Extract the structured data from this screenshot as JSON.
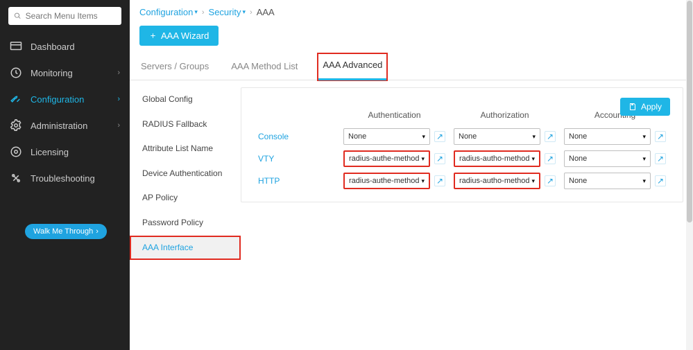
{
  "search": {
    "placeholder": "Search Menu Items"
  },
  "nav": {
    "items": [
      {
        "label": "Dashboard"
      },
      {
        "label": "Monitoring"
      },
      {
        "label": "Configuration"
      },
      {
        "label": "Administration"
      },
      {
        "label": "Licensing"
      },
      {
        "label": "Troubleshooting"
      }
    ]
  },
  "walk": {
    "label": "Walk Me Through"
  },
  "breadcrumb": {
    "a": "Configuration",
    "b": "Security",
    "c": "AAA"
  },
  "wizard": {
    "label": "AAA Wizard"
  },
  "tabs": [
    {
      "label": "Servers / Groups"
    },
    {
      "label": "AAA Method List"
    },
    {
      "label": "AAA Advanced"
    }
  ],
  "subnav": [
    {
      "label": "Global Config"
    },
    {
      "label": "RADIUS Fallback"
    },
    {
      "label": "Attribute List Name"
    },
    {
      "label": "Device Authentication"
    },
    {
      "label": "AP Policy"
    },
    {
      "label": "Password Policy"
    },
    {
      "label": "AAA Interface"
    }
  ],
  "panel": {
    "apply": "Apply",
    "cols": {
      "authn": "Authentication",
      "authz": "Authorization",
      "acct": "Accounting"
    },
    "rows": [
      {
        "label": "Console",
        "authn": "None",
        "authz": "None",
        "acct": "None",
        "hl_authn": false,
        "hl_authz": false
      },
      {
        "label": "VTY",
        "authn": "radius-authe-method",
        "authz": "radius-autho-method",
        "acct": "None",
        "hl_authn": true,
        "hl_authz": true
      },
      {
        "label": "HTTP",
        "authn": "radius-authe-method",
        "authz": "radius-autho-method",
        "acct": "None",
        "hl_authn": true,
        "hl_authz": true
      }
    ]
  }
}
